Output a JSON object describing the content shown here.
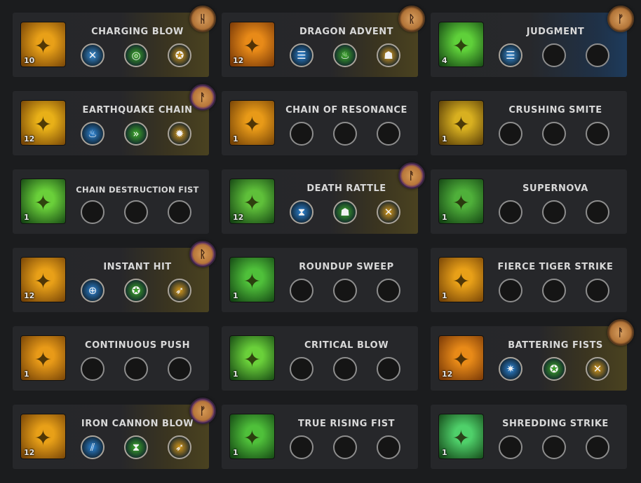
{
  "skills": [
    {
      "name": "CHARGING BLOW",
      "level": "10",
      "rank_glow": "gold",
      "icon": "charging-beast-icon",
      "icon_colors": [
        "#6a3a05",
        "#e8a018"
      ],
      "runes": [
        {
          "icon": "cross-blades-icon",
          "color": "#3a8fd8",
          "glyph": "✕"
        },
        {
          "icon": "swirl-icon",
          "color": "#3fae2a",
          "glyph": "◎"
        },
        {
          "icon": "beast-mask-icon",
          "color": "#d89a1a",
          "glyph": "✪"
        }
      ],
      "legendary_rune": {
        "icon": "legendary-rune-h-icon",
        "glyph": "ᚺ",
        "style": "brown"
      }
    },
    {
      "name": "DRAGON ADVENT",
      "level": "12",
      "rank_glow": "gold",
      "icon": "dragon-figure-icon",
      "icon_colors": [
        "#6a2e05",
        "#e88a18"
      ],
      "runes": [
        {
          "icon": "wind-lines-icon",
          "color": "#2d86d8",
          "glyph": "☰"
        },
        {
          "icon": "flame-icon",
          "color": "#3fae2a",
          "glyph": "♨"
        },
        {
          "icon": "figure-icon",
          "color": "#e0a020",
          "glyph": "☗"
        }
      ],
      "legendary_rune": {
        "icon": "legendary-rune-r-icon",
        "glyph": "ᚱ",
        "style": "brown"
      }
    },
    {
      "name": "JUDGMENT",
      "level": "4",
      "rank_glow": "blue",
      "icon": "judgment-dragon-icon",
      "icon_colors": [
        "#0e3a10",
        "#5fd03a"
      ],
      "runes": [
        {
          "icon": "wind-lines-icon",
          "color": "#3a8fd8",
          "glyph": "☰"
        }
      ],
      "legendary_rune": {
        "icon": "legendary-rune-f-icon",
        "glyph": "ᚠ",
        "style": "brown"
      }
    },
    {
      "name": "EARTHQUAKE CHAIN",
      "level": "12",
      "rank_glow": "gold",
      "icon": "quake-fist-icon",
      "icon_colors": [
        "#6a3a05",
        "#e8b018"
      ],
      "runes": [
        {
          "icon": "flame-icon",
          "color": "#2d86d8",
          "glyph": "♨"
        },
        {
          "icon": "arrows-right-icon",
          "color": "#3fae2a",
          "glyph": "»"
        },
        {
          "icon": "burst-icon",
          "color": "#d89a1a",
          "glyph": "✹"
        }
      ],
      "legendary_rune": {
        "icon": "legendary-rune-a-icon",
        "glyph": "ᚨ",
        "style": "purple"
      }
    },
    {
      "name": "CHAIN OF RESONANCE",
      "level": "1",
      "rank_glow": "none",
      "icon": "chained-monk-icon",
      "icon_colors": [
        "#6a3a05",
        "#e89a18"
      ],
      "runes": [],
      "legendary_rune": null
    },
    {
      "name": "CRUSHING SMITE",
      "level": "1",
      "rank_glow": "none",
      "icon": "beast-lightning-icon",
      "icon_colors": [
        "#4a3005",
        "#d8b020"
      ],
      "runes": [],
      "legendary_rune": null
    },
    {
      "name": "CHAIN DESTRUCTION FIST",
      "level": "1",
      "rank_glow": "none",
      "icon": "fist-burst-icon",
      "icon_colors": [
        "#0e3a10",
        "#6ad03a"
      ],
      "runes": [],
      "legendary_rune": null
    },
    {
      "name": "DEATH RATTLE",
      "level": "12",
      "rank_glow": "gold",
      "icon": "serpent-icon",
      "icon_colors": [
        "#0e3a10",
        "#5fc03a"
      ],
      "runes": [
        {
          "icon": "hourglass-icon",
          "color": "#2d86d8",
          "glyph": "⧗"
        },
        {
          "icon": "figure-icon",
          "color": "#3fae2a",
          "glyph": "☗"
        },
        {
          "icon": "cross-blades-icon",
          "color": "#d89a1a",
          "glyph": "✕"
        }
      ],
      "legendary_rune": {
        "icon": "legendary-rune-a-icon",
        "glyph": "ᚨ",
        "style": "purple"
      }
    },
    {
      "name": "SUPERNOVA",
      "level": "1",
      "rank_glow": "none",
      "icon": "monk-aura-icon",
      "icon_colors": [
        "#0e3a10",
        "#4fb03a"
      ],
      "runes": [],
      "legendary_rune": null
    },
    {
      "name": "INSTANT HIT",
      "level": "12",
      "rank_glow": "gold",
      "icon": "fist-strike-icon",
      "icon_colors": [
        "#6a3a05",
        "#e8a018"
      ],
      "runes": [
        {
          "icon": "crosshair-icon",
          "color": "#2d86d8",
          "glyph": "⊕"
        },
        {
          "icon": "beast-mask-icon",
          "color": "#3fae2a",
          "glyph": "✪"
        },
        {
          "icon": "running-figure-icon",
          "color": "#d89a1a",
          "glyph": "➶"
        }
      ],
      "legendary_rune": {
        "icon": "legendary-rune-r-icon",
        "glyph": "ᚱ",
        "style": "purple"
      }
    },
    {
      "name": "ROUNDUP SWEEP",
      "level": "1",
      "rank_glow": "none",
      "icon": "sweep-slash-icon",
      "icon_colors": [
        "#0e3a10",
        "#4fc03a"
      ],
      "runes": [],
      "legendary_rune": null
    },
    {
      "name": "FIERCE TIGER STRIKE",
      "level": "1",
      "rank_glow": "none",
      "icon": "claw-slash-icon",
      "icon_colors": [
        "#6a3a05",
        "#e8a018"
      ],
      "runes": [],
      "legendary_rune": null
    },
    {
      "name": "CONTINUOUS PUSH",
      "level": "1",
      "rank_glow": "none",
      "icon": "palm-push-icon",
      "icon_colors": [
        "#6a3a05",
        "#e89a18"
      ],
      "runes": [],
      "legendary_rune": null
    },
    {
      "name": "CRITICAL BLOW",
      "level": "1",
      "rank_glow": "none",
      "icon": "green-fist-icon",
      "icon_colors": [
        "#0e3a10",
        "#6ad03a"
      ],
      "runes": [],
      "legendary_rune": null
    },
    {
      "name": "BATTERING FISTS",
      "level": "12",
      "rank_glow": "gold",
      "icon": "leaping-monk-icon",
      "icon_colors": [
        "#6a2e05",
        "#e88a18"
      ],
      "runes": [
        {
          "icon": "star-burst-icon",
          "color": "#2d86d8",
          "glyph": "✷"
        },
        {
          "icon": "beast-mask-icon",
          "color": "#3fae2a",
          "glyph": "✪"
        },
        {
          "icon": "cross-blades-icon",
          "color": "#d89a1a",
          "glyph": "✕"
        }
      ],
      "legendary_rune": {
        "icon": "legendary-rune-a-icon",
        "glyph": "ᚨ",
        "style": "brown"
      }
    },
    {
      "name": "IRON CANNON BLOW",
      "level": "12",
      "rank_glow": "gold",
      "icon": "cannon-strike-icon",
      "icon_colors": [
        "#6a3a05",
        "#e8a018"
      ],
      "runes": [
        {
          "icon": "claw-marks-icon",
          "color": "#2d86d8",
          "glyph": "⫽"
        },
        {
          "icon": "hourglass-icon",
          "color": "#3fae2a",
          "glyph": "⧗"
        },
        {
          "icon": "running-figure-icon",
          "color": "#d89a1a",
          "glyph": "➶"
        }
      ],
      "legendary_rune": {
        "icon": "legendary-rune-f-icon",
        "glyph": "ᚠ",
        "style": "purple"
      }
    },
    {
      "name": "TRUE RISING FIST",
      "level": "1",
      "rank_glow": "none",
      "icon": "rising-slash-icon",
      "icon_colors": [
        "#0e3a10",
        "#4fc03a"
      ],
      "runes": [],
      "legendary_rune": null
    },
    {
      "name": "SHREDDING STRIKE",
      "level": "1",
      "rank_glow": "none",
      "icon": "spirit-monk-icon",
      "icon_colors": [
        "#0e3a10",
        "#4fd06a"
      ],
      "runes": [],
      "legendary_rune": null
    }
  ]
}
